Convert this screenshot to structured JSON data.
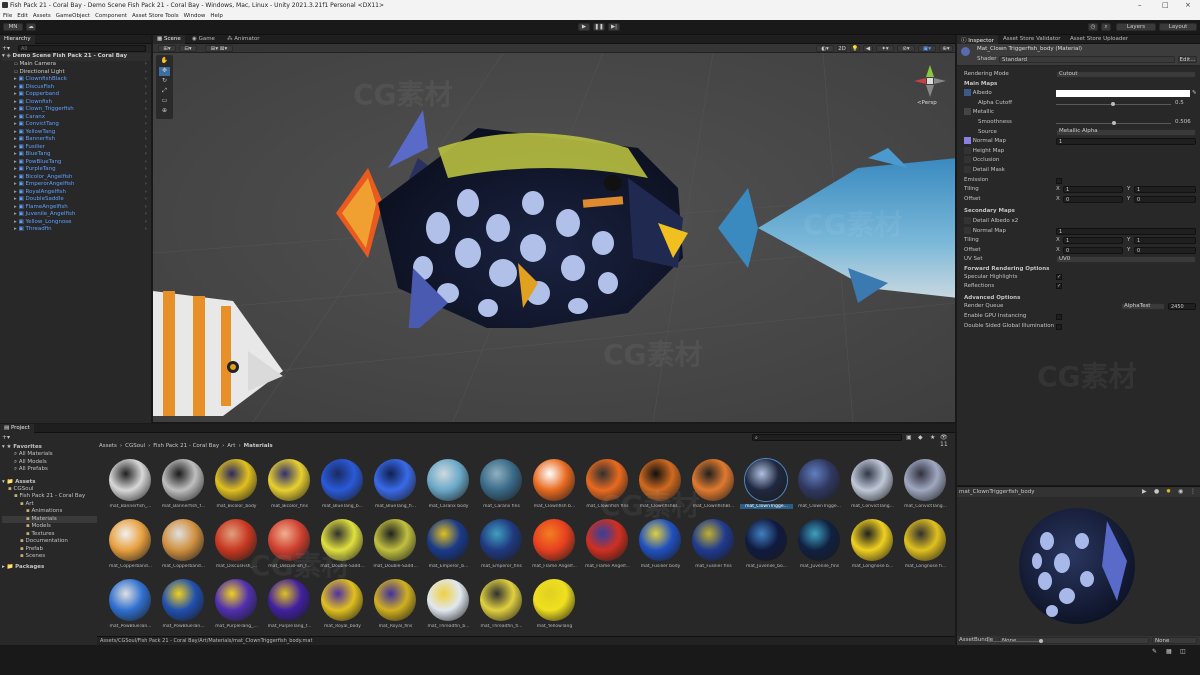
{
  "window": {
    "title": "Fish Pack 21 - Coral Bay - Demo Scene Fish Pack 21 - Coral Bay - Windows, Mac, Linux - Unity 2021.3.21f1 Personal <DX11>"
  },
  "menu": [
    "File",
    "Edit",
    "Assets",
    "GameObject",
    "Component",
    "Asset Store Tools",
    "Window",
    "Help"
  ],
  "toolbar": {
    "account": "MN",
    "layers": "Layers",
    "layout": "Layout"
  },
  "hierarchy": {
    "tab": "Hierarchy",
    "search_placeholder": "All",
    "scene": "Demo Scene Fish Pack 21 - Coral Bay",
    "items": [
      {
        "label": "Main Camera",
        "color": "white"
      },
      {
        "label": "Directional Light",
        "color": "white"
      },
      {
        "label": "ClownfishBlack",
        "color": "blue"
      },
      {
        "label": "DiscusFish",
        "color": "blue"
      },
      {
        "label": "Copperband",
        "color": "blue"
      },
      {
        "label": "Clownfish",
        "color": "blue"
      },
      {
        "label": "Clown_Triggerfish",
        "color": "blue"
      },
      {
        "label": "Caranx",
        "color": "blue"
      },
      {
        "label": "ConvictTang",
        "color": "blue"
      },
      {
        "label": "YellowTang",
        "color": "blue"
      },
      {
        "label": "Bannerfish",
        "color": "blue"
      },
      {
        "label": "Fusilier",
        "color": "blue"
      },
      {
        "label": "BlueTang",
        "color": "blue"
      },
      {
        "label": "PowBlueTang",
        "color": "blue"
      },
      {
        "label": "PurpleTang",
        "color": "blue"
      },
      {
        "label": "Bicolor_Angelfish",
        "color": "blue"
      },
      {
        "label": "EmperorAngelfish",
        "color": "blue"
      },
      {
        "label": "RoyalAngelfish",
        "color": "blue"
      },
      {
        "label": "DoubleSaddle",
        "color": "blue"
      },
      {
        "label": "FlameAngelfish",
        "color": "blue"
      },
      {
        "label": "Juvenile_Angelfish",
        "color": "blue"
      },
      {
        "label": "Yellow_Longnose",
        "color": "blue"
      },
      {
        "label": "Threadfin",
        "color": "blue"
      }
    ]
  },
  "scene_tabs": [
    "Scene",
    "Game",
    "Animator"
  ],
  "scene_view": {
    "persp": "<Persp",
    "zoom": "2D"
  },
  "inspector": {
    "tabs": [
      "Inspector",
      "Asset Store Validator",
      "Asset Store Uploader"
    ],
    "material_name": "Mat_Clown Triggerfish_body (Material)",
    "shader_label": "Shader",
    "shader_value": "Standard",
    "edit_button": "Edit...",
    "rendering_mode_label": "Rendering Mode",
    "rendering_mode_value": "Cutout",
    "main_maps": "Main Maps",
    "albedo": "Albedo",
    "alpha_cutoff": "Alpha Cutoff",
    "alpha_cutoff_value": "0.5",
    "metallic": "Metallic",
    "smoothness": "Smoothness",
    "smoothness_value": "0.506",
    "source": "Source",
    "source_value": "Metallic Alpha",
    "normal_map": "Normal Map",
    "normal_map_value": "1",
    "height_map": "Height Map",
    "occlusion": "Occlusion",
    "detail_mask": "Detail Mask",
    "emission": "Emission",
    "tiling": "Tiling",
    "offset": "Offset",
    "tiling_x": "1",
    "tiling_y": "1",
    "offset_x": "0",
    "offset_y": "0",
    "secondary_maps": "Secondary Maps",
    "detail_albedo": "Detail Albedo x2",
    "normal_map2": "Normal Map",
    "normal_map2_value": "1",
    "tiling2_x": "1",
    "tiling2_y": "1",
    "offset2_x": "0",
    "offset2_y": "0",
    "uv_set": "UV Set",
    "uv_set_value": "UV0",
    "forward_options": "Forward Rendering Options",
    "specular_highlights": "Specular Highlights",
    "reflections": "Reflections",
    "advanced_options": "Advanced Options",
    "render_queue": "Render Queue",
    "render_queue_mode": "AlphaTest",
    "render_queue_value": "2450",
    "gpu_instancing": "Enable GPU Instancing",
    "double_sided_gi": "Double Sided Global Illumination",
    "x": "X",
    "y": "Y",
    "preview_name": "mat_ClownTriggerfish_body",
    "assetbundle_label": "AssetBundle",
    "assetbundle_value": "None",
    "assetbundle_variant": "None"
  },
  "project": {
    "tab": "Project",
    "favorites": "Favorites",
    "favorites_items": [
      "All Materials",
      "All Models",
      "All Prefabs"
    ],
    "assets": "Assets",
    "tree": [
      {
        "label": "CGSoul",
        "indent": 1
      },
      {
        "label": "Fish Pack 21 - Coral Bay",
        "indent": 2
      },
      {
        "label": "Art",
        "indent": 3
      },
      {
        "label": "Animations",
        "indent": 4
      },
      {
        "label": "Materials",
        "indent": 4
      },
      {
        "label": "Models",
        "indent": 4
      },
      {
        "label": "Textures",
        "indent": 4
      },
      {
        "label": "Documentation",
        "indent": 3
      },
      {
        "label": "Prefab",
        "indent": 3
      },
      {
        "label": "Scenes",
        "indent": 3
      }
    ],
    "packages": "Packages",
    "breadcrumb": [
      "Assets",
      "CGSoul",
      "Fish Pack 21 - Coral Bay",
      "Art",
      "Materials"
    ],
    "path": "Assets/CGSoul/Fish Pack 21 - Coral Bay/Art/Materials/mat_ClownTriggerfish_body.mat",
    "items_count": "11",
    "materials": [
      {
        "label": "mat_Bannerfish_...",
        "c1": "#d8d8d8",
        "c2": "#202020"
      },
      {
        "label": "mat_Bannerfish_f...",
        "c1": "#bfbfbf",
        "c2": "#1a1a1a"
      },
      {
        "label": "mat_Bicolor_body",
        "c1": "#e0c020",
        "c2": "#2a2a60"
      },
      {
        "label": "mat_Bicolor_fins",
        "c1": "#e8d030",
        "c2": "#303070"
      },
      {
        "label": "mat_BlueTang_b...",
        "c1": "#2a5ad8",
        "c2": "#1a2a60"
      },
      {
        "label": "mat_BlueTang_fi...",
        "c1": "#3a6ae8",
        "c2": "#102050"
      },
      {
        "label": "mat_Caranx body",
        "c1": "#6aa8c8",
        "c2": "#d0d8e0"
      },
      {
        "label": "mat_Caranx fins",
        "c1": "#3a6a88",
        "c2": "#90b0c0"
      },
      {
        "label": "mat_Clownfish b...",
        "c1": "#e86a20",
        "c2": "#ffffff"
      },
      {
        "label": "mat_Clownfish fins",
        "c1": "#e86a20",
        "c2": "#303030"
      },
      {
        "label": "mat_ClownfishBl...",
        "c1": "#d06a20",
        "c2": "#101010"
      },
      {
        "label": "mat_ClownfishBl...",
        "c1": "#e07a30",
        "c2": "#202020"
      },
      {
        "label": "mat_ClownTrigge...",
        "c1": "#202840",
        "c2": "#b0c0e0"
      },
      {
        "label": "mat_ClownTrigge...",
        "c1": "#303860",
        "c2": "#6080c0"
      },
      {
        "label": "mat_ConvictTang...",
        "c1": "#c0c8d8",
        "c2": "#303848"
      },
      {
        "label": "mat_ConvictTang...",
        "c1": "#a0a8c0",
        "c2": "#303040"
      },
      {
        "label": "mat_Copperband...",
        "c1": "#e8a040",
        "c2": "#f0f0f0"
      },
      {
        "label": "mat_Copperband...",
        "c1": "#d09040",
        "c2": "#e0e0e0"
      },
      {
        "label": "mat_DiscusFish_...",
        "c1": "#c83820",
        "c2": "#e0a080"
      },
      {
        "label": "mat_DiscusFish_f...",
        "c1": "#d04030",
        "c2": "#f0b090"
      },
      {
        "label": "mat_Double-Sadd...",
        "c1": "#e0e040",
        "c2": "#303030"
      },
      {
        "label": "mat_Double-Sadd...",
        "c1": "#c0c040",
        "c2": "#202020"
      },
      {
        "label": "mat_Emperor_b...",
        "c1": "#1a3a8a",
        "c2": "#e0c020"
      },
      {
        "label": "mat_Emperor_fins",
        "c1": "#203a80",
        "c2": "#40a0c0"
      },
      {
        "label": "mat_Flame Angelf...",
        "c1": "#e84020",
        "c2": "#f08020"
      },
      {
        "label": "mat_Flame Angelf...",
        "c1": "#d03020",
        "c2": "#3040a0"
      },
      {
        "label": "mat_Fusilier body",
        "c1": "#2050c0",
        "c2": "#e0d040"
      },
      {
        "label": "mat_Fusilier fins",
        "c1": "#203a90",
        "c2": "#c0b030"
      },
      {
        "label": "mat_Juvenile_bo...",
        "c1": "#101a40",
        "c2": "#4080c0"
      },
      {
        "label": "mat_Juvenile_fins",
        "c1": "#102040",
        "c2": "#40a0c0"
      },
      {
        "label": "mat_Longnose b...",
        "c1": "#f0d020",
        "c2": "#202020"
      },
      {
        "label": "mat_Longnose fi...",
        "c1": "#e0c020",
        "c2": "#303030"
      },
      {
        "label": "mat_PowBlueTan...",
        "c1": "#3070d0",
        "c2": "#e0e0e0"
      },
      {
        "label": "mat_PowBlueTan...",
        "c1": "#2050b0",
        "c2": "#f0d020"
      },
      {
        "label": "mat_PurpleTang_...",
        "c1": "#5030b0",
        "c2": "#f0d020"
      },
      {
        "label": "mat_PurpleTang_f...",
        "c1": "#4020a0",
        "c2": "#e0c020"
      },
      {
        "label": "mat_Royal_body",
        "c1": "#e0c020",
        "c2": "#5030a0"
      },
      {
        "label": "mat_Royal_fins",
        "c1": "#d0b020",
        "c2": "#4030a0"
      },
      {
        "label": "mat_Threadfin_b...",
        "c1": "#e0e8f0",
        "c2": "#f0d040"
      },
      {
        "label": "mat_Threadfin_fi...",
        "c1": "#e0d040",
        "c2": "#303030"
      },
      {
        "label": "mat_YellowTang",
        "c1": "#f0e020",
        "c2": "#e0d020"
      }
    ],
    "selected_index": 12
  },
  "watermark": "CG素材"
}
